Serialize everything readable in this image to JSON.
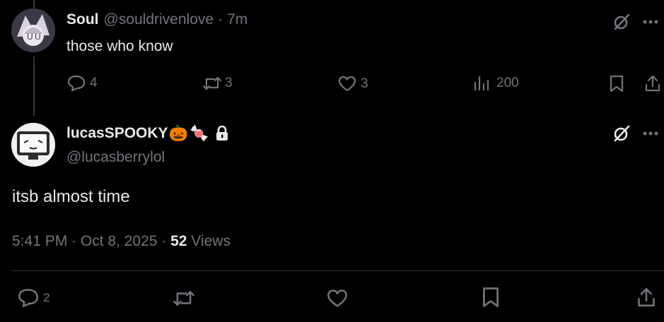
{
  "reply": {
    "name": "Soul",
    "handle": "@souldrivenlove",
    "time": "7m",
    "text": "those who know",
    "counts": {
      "replies": "4",
      "reposts": "3",
      "likes": "3",
      "views": "200"
    }
  },
  "main": {
    "name": "lucasSPOOKY",
    "emojis": [
      "🎃",
      "🍬"
    ],
    "handle": "@lucasberrylol",
    "text": "itsb almost time",
    "time": "5:41 PM · Oct 8, 2025 · ",
    "views_count": "52",
    "views_label": " Views",
    "counts": {
      "replies": "2"
    }
  },
  "icons": [
    "grok-icon",
    "more-icon",
    "reply-icon",
    "repost-icon",
    "like-icon",
    "views-icon",
    "bookmark-icon",
    "share-icon",
    "lock-icon"
  ],
  "colors": {
    "background": "#000000",
    "text": "#e7e9ea",
    "muted": "#71767b",
    "divider": "#2f3336"
  }
}
